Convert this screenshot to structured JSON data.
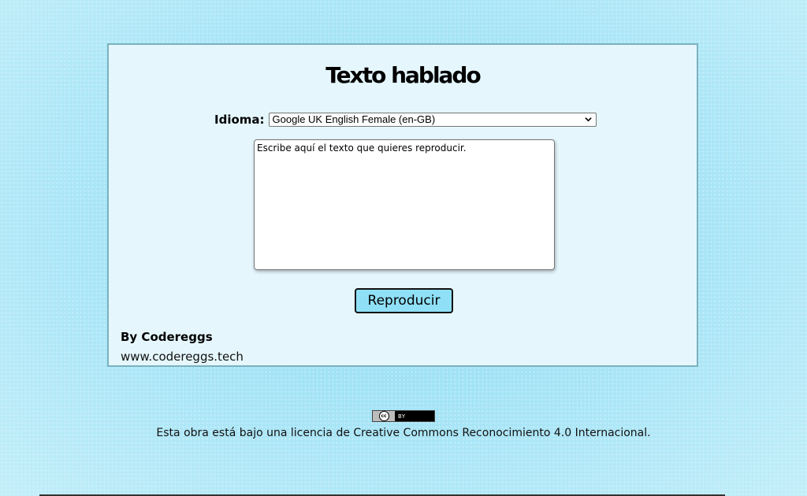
{
  "app": {
    "title": "Texto hablado"
  },
  "language": {
    "label": "Idioma:",
    "selected": "Google UK English Female (en-GB)",
    "chevron_icon": "chevron-down-icon"
  },
  "textbox": {
    "value": "Escribe aquí el texto que quieres reproducir."
  },
  "actions": {
    "play_label": "Reproducir"
  },
  "credits": {
    "author": "By Codereggs",
    "website": "www.codereggs.tech"
  },
  "license": {
    "badge_cc": "cc",
    "badge_by": "BY",
    "text": "Esta obra está bajo una licencia de Creative Commons Reconocimiento 4.0 Internacional."
  },
  "colors": {
    "background": "#a6e4f5",
    "card": "#e5f7fd",
    "card_border": "#7ab2bf",
    "button": "#8fe0f7"
  }
}
